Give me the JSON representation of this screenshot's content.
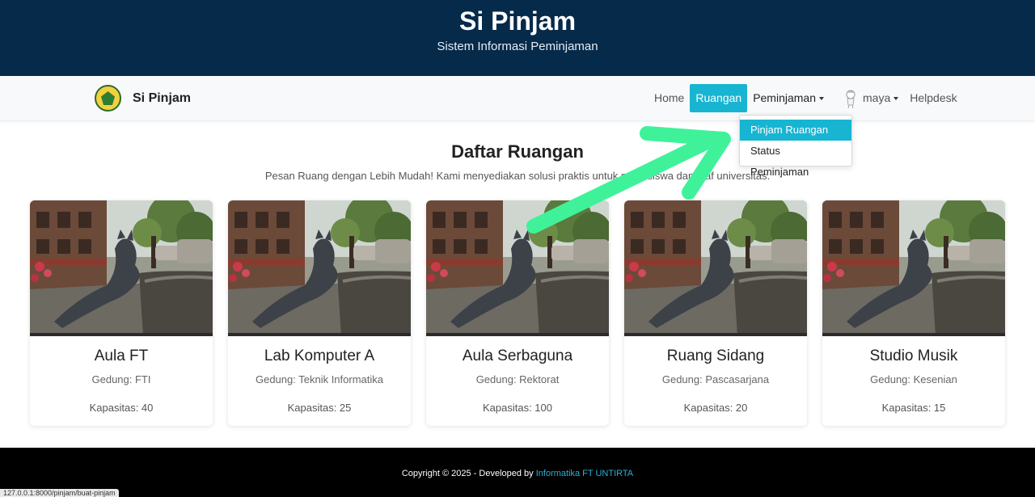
{
  "header": {
    "title": "Si Pinjam",
    "subtitle": "Sistem Informasi Peminjaman"
  },
  "navbar": {
    "brand": "Si Pinjam",
    "items": [
      {
        "label": "Home"
      },
      {
        "label": "Ruangan",
        "active": true
      },
      {
        "label": "Peminjaman"
      },
      {
        "label": "maya"
      },
      {
        "label": "Helpdesk"
      }
    ],
    "dropdown": [
      {
        "label": "Pinjam Ruangan",
        "highlighted": true
      },
      {
        "label": "Status Peminjaman"
      }
    ]
  },
  "main": {
    "title": "Daftar Ruangan",
    "description": "Pesan Ruang dengan Lebih Mudah! Kami menyediakan solusi praktis untuk mahasiswa dan staf universitas."
  },
  "cards": [
    {
      "name": "Aula FT",
      "building": "Gedung: FTI",
      "capacity": "Kapasitas: 40"
    },
    {
      "name": "Lab Komputer A",
      "building": "Gedung: Teknik Informatika",
      "capacity": "Kapasitas: 25"
    },
    {
      "name": "Aula Serbaguna",
      "building": "Gedung: Rektorat",
      "capacity": "Kapasitas: 100"
    },
    {
      "name": "Ruang Sidang",
      "building": "Gedung: Pascasarjana",
      "capacity": "Kapasitas: 20"
    },
    {
      "name": "Studio Musik",
      "building": "Gedung: Kesenian",
      "capacity": "Kapasitas: 15"
    }
  ],
  "footer": {
    "text": "Copyright © 2025 - Developed by ",
    "link": "Informatika FT UNTIRTA"
  },
  "status_url": "127.0.0.1:8000/pinjam/buat-pinjam",
  "colors": {
    "header_bg": "#052a4a",
    "accent": "#17b5d2",
    "arrow": "#3ff29a"
  }
}
